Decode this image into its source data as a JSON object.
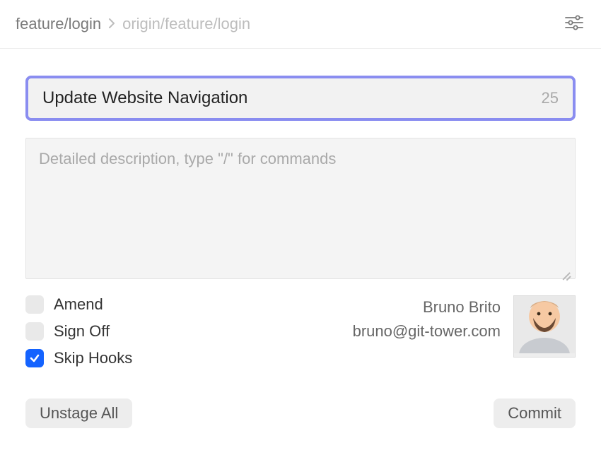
{
  "breadcrumb": {
    "local_branch": "feature/login",
    "remote_branch": "origin/feature/login"
  },
  "commit": {
    "subject": "Update Website Navigation",
    "subject_char_count": "25",
    "description_placeholder": "Detailed description, type \"/\" for commands"
  },
  "options": {
    "amend": {
      "label": "Amend",
      "checked": false
    },
    "sign_off": {
      "label": "Sign Off",
      "checked": false
    },
    "skip_hooks": {
      "label": "Skip Hooks",
      "checked": true
    }
  },
  "author": {
    "name": "Bruno Brito",
    "email": "bruno@git-tower.com"
  },
  "buttons": {
    "unstage_all": "Unstage All",
    "commit": "Commit"
  }
}
